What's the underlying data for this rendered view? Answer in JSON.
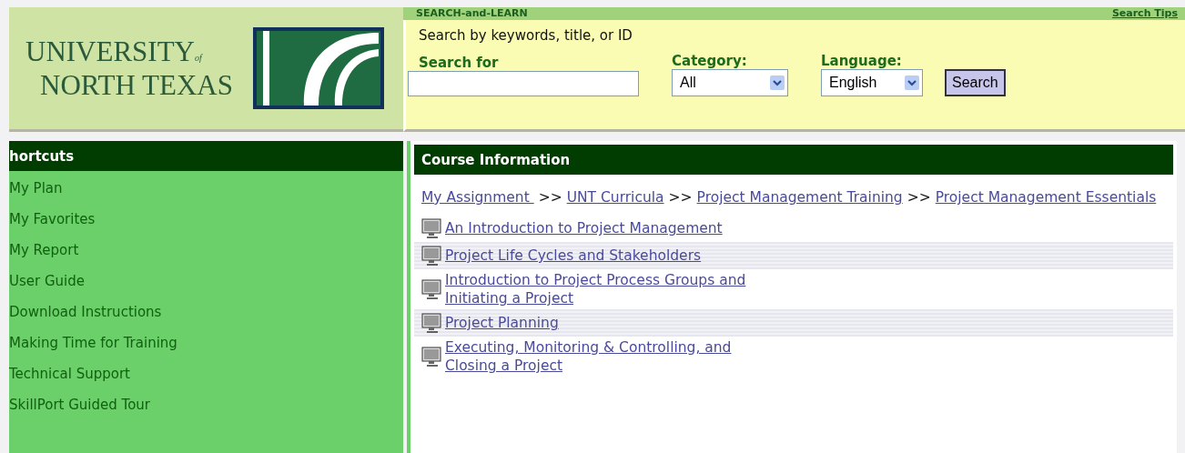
{
  "logo": {
    "line_1": "UNIVERSITY",
    "of": "of",
    "line_2": "NORTH TEXAS"
  },
  "search": {
    "heading": "SEARCH-and-LEARN",
    "tips_link": "Search Tips",
    "hint": "Search by keywords, title, or ID",
    "search_for_label": "Search for",
    "category_label": "Category:",
    "category_value": "All",
    "language_label": "Language:",
    "language_value": "English",
    "button": "Search"
  },
  "sidebar": {
    "title": "hortcuts",
    "items": [
      {
        "label": "My Plan"
      },
      {
        "label": "My Favorites"
      },
      {
        "label": "My Report"
      },
      {
        "label": "User Guide"
      },
      {
        "label": "Download Instructions"
      },
      {
        "label": "Making Time for Training"
      },
      {
        "label": "Technical Support"
      },
      {
        "label": "SkillPort Guided Tour"
      }
    ]
  },
  "course": {
    "title": "Course Information",
    "breadcrumb": [
      {
        "label": "My Assignment ",
        "separator": ">>"
      },
      {
        "label": "UNT Curricula",
        "separator": ">>"
      },
      {
        "label": "Project Management Training",
        "separator": ">>"
      },
      {
        "label": "Project Management Essentials"
      }
    ],
    "courses": [
      {
        "lines": [
          "An Introduction to Project Management"
        ]
      },
      {
        "lines": [
          "Project Life Cycles and Stakeholders"
        ]
      },
      {
        "lines": [
          "Introduction to Project Process Groups and",
          "Initiating a Project"
        ]
      },
      {
        "lines": [
          "Project Planning"
        ]
      },
      {
        "lines": [
          "Executing, Monitoring & Controlling, and",
          "Closing a Project"
        ]
      }
    ]
  }
}
